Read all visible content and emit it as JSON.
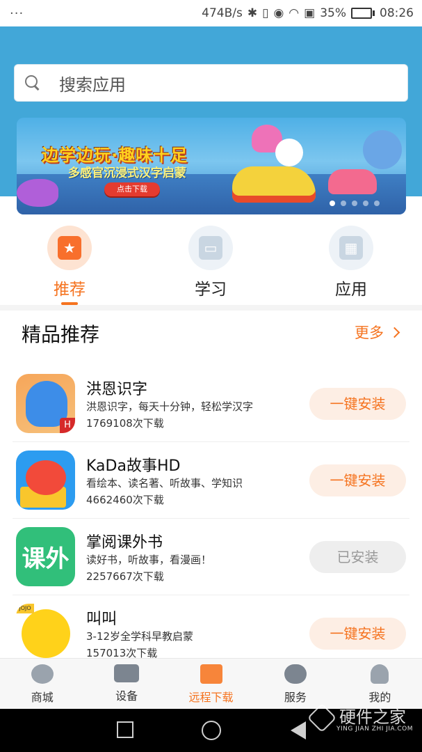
{
  "status_bar": {
    "menu_dots": "···",
    "net_speed": "474B/s",
    "battery_pct": "35%",
    "battery_level": 0.35,
    "time": "08:26",
    "colors": {
      "battery_fill": "#3cb043"
    }
  },
  "search": {
    "placeholder": "搜索应用"
  },
  "banner": {
    "headline": "边学边玩·趣味十足",
    "subline": "多感官沉浸式汉字启蒙",
    "cta": "点击下载",
    "page_count": 5,
    "active_page": 1
  },
  "categories": [
    {
      "label": "推荐",
      "icon": "star-icon",
      "active": true
    },
    {
      "label": "学习",
      "icon": "book-icon",
      "active": false
    },
    {
      "label": "应用",
      "icon": "grid-icon",
      "active": false
    }
  ],
  "section": {
    "title": "精品推荐",
    "more": "更多"
  },
  "apps": [
    {
      "name": "洪恩识字",
      "desc": "洪恩识字，每天十分钟，轻松学汉字",
      "downloads": "1769108次下载",
      "button": "一键安装",
      "installed": false,
      "badge": "H"
    },
    {
      "name": "KaDa故事HD",
      "desc": "看绘本、读名著、听故事、学知识",
      "downloads": "4662460次下载",
      "button": "一键安装",
      "installed": false
    },
    {
      "name": "掌阅课外书",
      "desc": "读好书，听故事，看漫画！",
      "downloads": "2257667次下载",
      "button": "已安装",
      "installed": true,
      "icon_text": "课外"
    },
    {
      "name": "叫叫",
      "desc": "3-12岁全学科早教启蒙",
      "downloads": "157013次下载",
      "button": "一键安装",
      "installed": false,
      "icon_tag": "JOJO"
    }
  ],
  "bottom_nav": [
    {
      "label": "商城",
      "icon": "shop-icon",
      "active": false
    },
    {
      "label": "设备",
      "icon": "device-icon",
      "active": false
    },
    {
      "label": "远程下载",
      "icon": "download-bag-icon",
      "active": true
    },
    {
      "label": "服务",
      "icon": "service-icon",
      "active": false
    },
    {
      "label": "我的",
      "icon": "profile-icon",
      "active": false
    }
  ],
  "watermark": {
    "title": "硬件之家",
    "subtitle": "YING JIAN ZHI JIA.COM"
  },
  "colors": {
    "header_blue": "#42a7d8",
    "accent_orange": "#f5731f"
  }
}
